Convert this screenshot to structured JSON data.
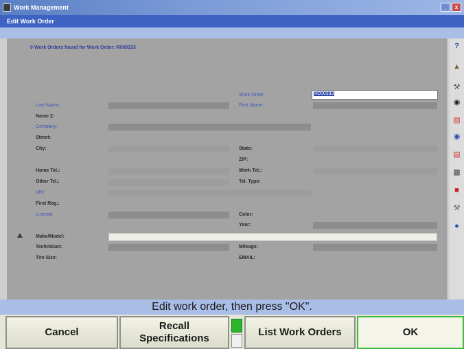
{
  "window": {
    "title": "Work Management"
  },
  "header": {
    "subtitle": "Edit Work Order"
  },
  "found_message": "0 Work Orders found for Work Order: R000333",
  "form": {
    "work_order_label": "Work Order:",
    "work_order_value": "R000333",
    "last_name_label": "Last Name:",
    "first_name_label": "First Name:",
    "name2_label": "Name 2:",
    "company_label": "Company:",
    "street_label": "Street:",
    "city_label": "City:",
    "state_label": "State:",
    "zip_label": "ZIP:",
    "home_tel_label": "Home Tel.:",
    "work_tel_label": "Work Tel.:",
    "other_tel_label": "Other Tel.:",
    "tel_type_label": "Tel. Type:",
    "vin_label": "VIN:",
    "first_reg_label": "First Reg.:",
    "license_label": "License:",
    "color_label": "Color:",
    "year_label": "Year:",
    "make_model_label": "Make/Model:",
    "technician_label": "Technician:",
    "mileage_label": "Mileage:",
    "tire_size_label": "Tire Size:",
    "email_label": "EMAIL:"
  },
  "status": "Edit work order, then press \"OK\".",
  "buttons": {
    "cancel": "Cancel",
    "recall_line1": "Recall",
    "recall_line2": "Specifications",
    "list": "List Work Orders",
    "ok": "OK"
  },
  "icons": [
    "help-icon",
    "car-lift-icon",
    "tools-icon",
    "wheel-icon",
    "alignment-icon",
    "sensor-icon",
    "gauge-icon",
    "printer-icon",
    "database-icon",
    "wrench-icon",
    "globe-icon"
  ],
  "colors": {
    "accent": "#3f63c2",
    "panel": "#a3a3a3",
    "ok_border": "#3ebc3e"
  }
}
